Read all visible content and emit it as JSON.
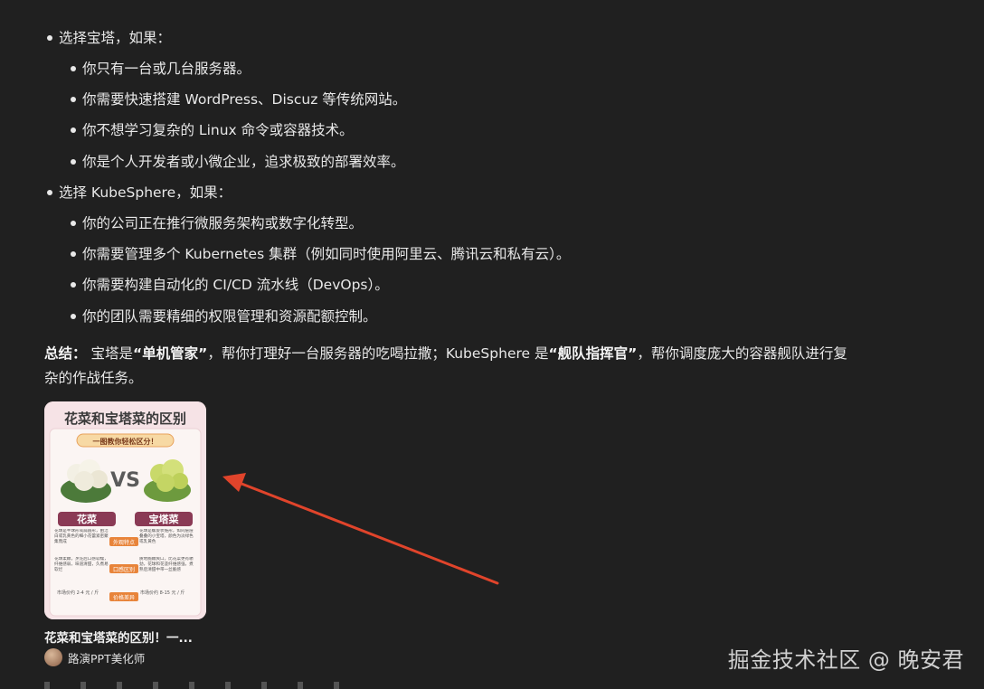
{
  "list": {
    "group1": {
      "label": "选择宝塔，如果：",
      "items": [
        "你只有一台或几台服务器。",
        "你需要快速搭建 WordPress、Discuz 等传统网站。",
        "你不想学习复杂的 Linux 命令或容器技术。",
        "你是个人开发者或小微企业，追求极致的部署效率。"
      ]
    },
    "group2": {
      "label": "选择 KubeSphere，如果：",
      "items": [
        "你的公司正在推行微服务架构或数字化转型。",
        "你需要管理多个 Kubernetes 集群（例如同时使用阿里云、腾讯云和私有云）。",
        "你需要构建自动化的 CI/CD 流水线（DevOps）。",
        "你的团队需要精细的权限管理和资源配额控制。"
      ]
    }
  },
  "summary": {
    "label": "总结：",
    "t1": "宝塔是",
    "b1": "“单机管家”",
    "t2": "，帮你打理好一台服务器的吃喝拉撒；KubeSphere 是",
    "b2": "“舰队指挥官”",
    "t3": "，帮你调度庞大的容器舰队进行复杂的作战任务。"
  },
  "card": {
    "poster": {
      "title": "花菜和宝塔菜的区别",
      "subtitle": "一图教你轻松区分！",
      "vs": "VS",
      "left_name": "花菜",
      "right_name": "宝塔菜",
      "left_desc1": "花球是半球形或扁圆形，由洁白或乳黄色的细小花蕾紧密聚集而成",
      "right_desc1": "花球是螺旋状锥形，如同层层叠叠的小宝塔，颜色为淡绿色或乳黄色",
      "tag1": "外观特点",
      "left_desc2": "花球柔嫩，烹饪后口感软糯，纤维感弱，味道清甜，久煮易软烂",
      "right_desc2": "质地脆嫩爽口，比花菜更有嚼劲，花球和花茎纤维感强，煮熟后清甜中带一丝脆感",
      "tag2": "口感区别",
      "left_price": "市场价约 2-4 元 / 斤",
      "right_price": "市场价约 8-15 元 / 斤",
      "tag3": "价格差异"
    },
    "title": "花菜和宝塔菜的区别！一...",
    "author": "路演PPT美化师"
  },
  "watermark": "掘金技术社区 @ 晚安君",
  "colors": {
    "background": "#202020",
    "text": "#e8e8e8",
    "arrow": "#e0442b"
  }
}
